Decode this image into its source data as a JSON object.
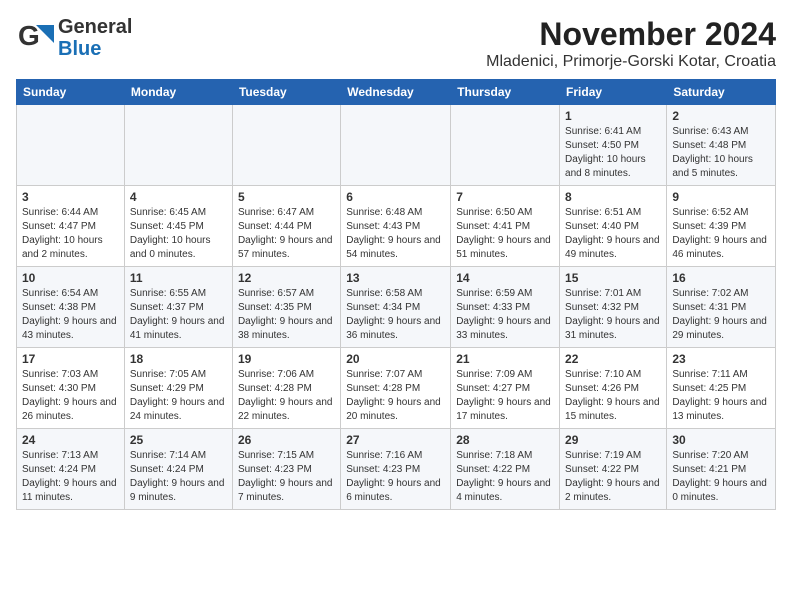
{
  "header": {
    "logo_general": "General",
    "logo_blue": "Blue",
    "title": "November 2024",
    "subtitle": "Mladenici, Primorje-Gorski Kotar, Croatia"
  },
  "days_of_week": [
    "Sunday",
    "Monday",
    "Tuesday",
    "Wednesday",
    "Thursday",
    "Friday",
    "Saturday"
  ],
  "weeks": [
    [
      {
        "day": "",
        "info": ""
      },
      {
        "day": "",
        "info": ""
      },
      {
        "day": "",
        "info": ""
      },
      {
        "day": "",
        "info": ""
      },
      {
        "day": "",
        "info": ""
      },
      {
        "day": "1",
        "info": "Sunrise: 6:41 AM\nSunset: 4:50 PM\nDaylight: 10 hours and 8 minutes."
      },
      {
        "day": "2",
        "info": "Sunrise: 6:43 AM\nSunset: 4:48 PM\nDaylight: 10 hours and 5 minutes."
      }
    ],
    [
      {
        "day": "3",
        "info": "Sunrise: 6:44 AM\nSunset: 4:47 PM\nDaylight: 10 hours and 2 minutes."
      },
      {
        "day": "4",
        "info": "Sunrise: 6:45 AM\nSunset: 4:45 PM\nDaylight: 10 hours and 0 minutes."
      },
      {
        "day": "5",
        "info": "Sunrise: 6:47 AM\nSunset: 4:44 PM\nDaylight: 9 hours and 57 minutes."
      },
      {
        "day": "6",
        "info": "Sunrise: 6:48 AM\nSunset: 4:43 PM\nDaylight: 9 hours and 54 minutes."
      },
      {
        "day": "7",
        "info": "Sunrise: 6:50 AM\nSunset: 4:41 PM\nDaylight: 9 hours and 51 minutes."
      },
      {
        "day": "8",
        "info": "Sunrise: 6:51 AM\nSunset: 4:40 PM\nDaylight: 9 hours and 49 minutes."
      },
      {
        "day": "9",
        "info": "Sunrise: 6:52 AM\nSunset: 4:39 PM\nDaylight: 9 hours and 46 minutes."
      }
    ],
    [
      {
        "day": "10",
        "info": "Sunrise: 6:54 AM\nSunset: 4:38 PM\nDaylight: 9 hours and 43 minutes."
      },
      {
        "day": "11",
        "info": "Sunrise: 6:55 AM\nSunset: 4:37 PM\nDaylight: 9 hours and 41 minutes."
      },
      {
        "day": "12",
        "info": "Sunrise: 6:57 AM\nSunset: 4:35 PM\nDaylight: 9 hours and 38 minutes."
      },
      {
        "day": "13",
        "info": "Sunrise: 6:58 AM\nSunset: 4:34 PM\nDaylight: 9 hours and 36 minutes."
      },
      {
        "day": "14",
        "info": "Sunrise: 6:59 AM\nSunset: 4:33 PM\nDaylight: 9 hours and 33 minutes."
      },
      {
        "day": "15",
        "info": "Sunrise: 7:01 AM\nSunset: 4:32 PM\nDaylight: 9 hours and 31 minutes."
      },
      {
        "day": "16",
        "info": "Sunrise: 7:02 AM\nSunset: 4:31 PM\nDaylight: 9 hours and 29 minutes."
      }
    ],
    [
      {
        "day": "17",
        "info": "Sunrise: 7:03 AM\nSunset: 4:30 PM\nDaylight: 9 hours and 26 minutes."
      },
      {
        "day": "18",
        "info": "Sunrise: 7:05 AM\nSunset: 4:29 PM\nDaylight: 9 hours and 24 minutes."
      },
      {
        "day": "19",
        "info": "Sunrise: 7:06 AM\nSunset: 4:28 PM\nDaylight: 9 hours and 22 minutes."
      },
      {
        "day": "20",
        "info": "Sunrise: 7:07 AM\nSunset: 4:28 PM\nDaylight: 9 hours and 20 minutes."
      },
      {
        "day": "21",
        "info": "Sunrise: 7:09 AM\nSunset: 4:27 PM\nDaylight: 9 hours and 17 minutes."
      },
      {
        "day": "22",
        "info": "Sunrise: 7:10 AM\nSunset: 4:26 PM\nDaylight: 9 hours and 15 minutes."
      },
      {
        "day": "23",
        "info": "Sunrise: 7:11 AM\nSunset: 4:25 PM\nDaylight: 9 hours and 13 minutes."
      }
    ],
    [
      {
        "day": "24",
        "info": "Sunrise: 7:13 AM\nSunset: 4:24 PM\nDaylight: 9 hours and 11 minutes."
      },
      {
        "day": "25",
        "info": "Sunrise: 7:14 AM\nSunset: 4:24 PM\nDaylight: 9 hours and 9 minutes."
      },
      {
        "day": "26",
        "info": "Sunrise: 7:15 AM\nSunset: 4:23 PM\nDaylight: 9 hours and 7 minutes."
      },
      {
        "day": "27",
        "info": "Sunrise: 7:16 AM\nSunset: 4:23 PM\nDaylight: 9 hours and 6 minutes."
      },
      {
        "day": "28",
        "info": "Sunrise: 7:18 AM\nSunset: 4:22 PM\nDaylight: 9 hours and 4 minutes."
      },
      {
        "day": "29",
        "info": "Sunrise: 7:19 AM\nSunset: 4:22 PM\nDaylight: 9 hours and 2 minutes."
      },
      {
        "day": "30",
        "info": "Sunrise: 7:20 AM\nSunset: 4:21 PM\nDaylight: 9 hours and 0 minutes."
      }
    ]
  ]
}
